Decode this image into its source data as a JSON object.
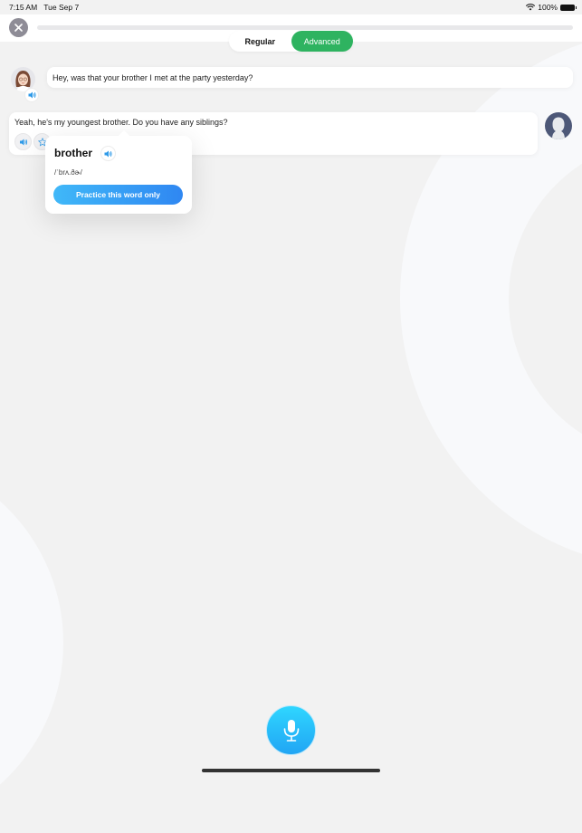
{
  "status_bar": {
    "time": "7:15 AM",
    "date": "Tue Sep 7",
    "battery": "100%",
    "wifi_icon": "wifi-icon",
    "battery_icon": "battery-icon"
  },
  "header": {
    "close_icon": "close-icon",
    "progress_percent": 0
  },
  "mode_toggle": {
    "options": [
      "Regular",
      "Advanced"
    ],
    "selected": "Advanced"
  },
  "conversation": [
    {
      "speaker": "bot",
      "text": "Hey, was that your brother I met at the party yesterday?"
    },
    {
      "speaker": "user",
      "text": "Yeah, he's my youngest brother. Do you have any siblings?"
    }
  ],
  "word_popover": {
    "word": "brother",
    "ipa": "/ˈbrʌ.ðɚ/",
    "button_label": "Practice this word only"
  },
  "colors": {
    "accent_green": "#2eb360",
    "accent_blue": "#2f87f2",
    "mic_blue": "#21a5f4",
    "user_avatar": "#4d5878"
  }
}
